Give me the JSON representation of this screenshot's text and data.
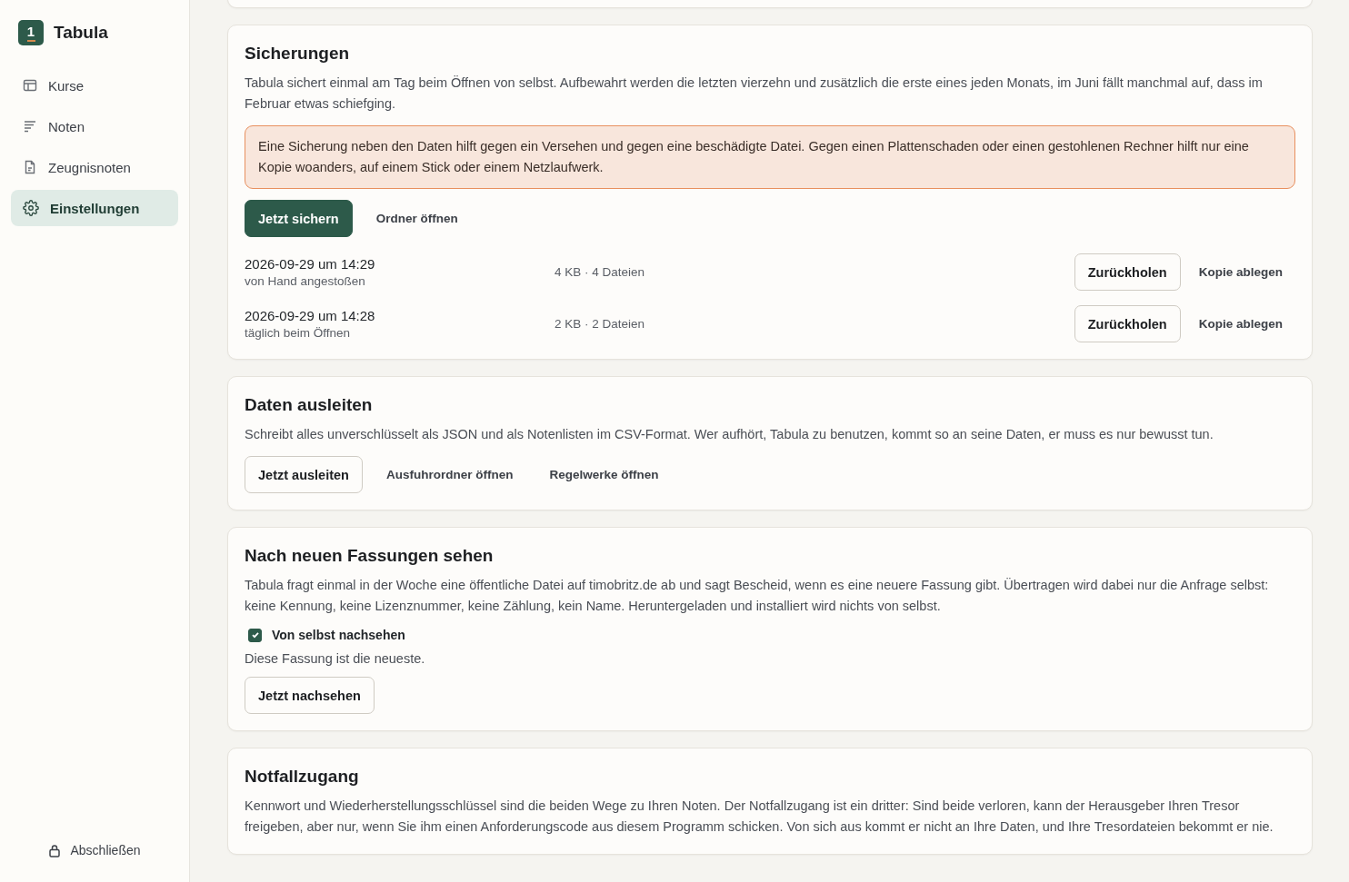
{
  "sidebar": {
    "app_name": "Tabula",
    "logo_text": "1",
    "items": [
      {
        "label": "Kurse",
        "selected": false
      },
      {
        "label": "Noten",
        "selected": false
      },
      {
        "label": "Zeugnisnoten",
        "selected": false
      },
      {
        "label": "Einstellungen",
        "selected": true
      }
    ],
    "lock_button": "Abschließen"
  },
  "sections": [
    {
      "title": "Sicherungen",
      "text": "Tabula sichert einmal am Tag beim Öffnen von selbst. Aufbewahrt werden die letzten vierzehn und zusätzlich die erste eines jeden Monats, im Juni fällt manchmal auf, dass im Februar etwas schiefging.",
      "notice": "Eine Sicherung neben den Daten hilft gegen ein Versehen und gegen eine beschädigte Datei. Gegen einen Plattenschaden oder einen gestohlenen Rechner hilft nur eine Kopie woanders, auf einem Stick oder einem Netzlaufwerk.",
      "buttons": [
        {
          "label": "Jetzt sichern",
          "kind": "primary"
        },
        {
          "label": "Ordner öffnen",
          "kind": "link"
        }
      ],
      "backups": [
        {
          "date": "2026-09-29 um 14:29",
          "origin": "von Hand angestoßen",
          "size": "4 KB · 4 Dateien",
          "restore": "Zurückholen",
          "copy": "Kopie ablegen"
        },
        {
          "date": "2026-09-29 um 14:28",
          "origin": "täglich beim Öffnen",
          "size": "2 KB · 2 Dateien",
          "restore": "Zurückholen",
          "copy": "Kopie ablegen"
        }
      ]
    },
    {
      "title": "Daten ausleiten",
      "text": "Schreibt alles unverschlüsselt als JSON und als Notenlisten im CSV-Format. Wer aufhört, Tabula zu benutzen, kommt so an seine Daten, er muss es nur bewusst tun.",
      "buttons": [
        {
          "label": "Jetzt ausleiten",
          "kind": "outline"
        },
        {
          "label": "Ausfuhrordner öffnen",
          "kind": "link"
        },
        {
          "label": "Regelwerke öffnen",
          "kind": "link"
        }
      ]
    },
    {
      "title": "Nach neuen Fassungen sehen",
      "text": "Tabula fragt einmal in der Woche eine öffentliche Datei auf timobritz.de ab und sagt Bescheid, wenn es eine neuere Fassung gibt. Übertragen wird dabei nur die Anfrage selbst: keine Kennung, keine Lizenznummer, keine Zählung, kein Name. Heruntergeladen und installiert wird nichts von selbst.",
      "checkbox": {
        "label": "Von selbst nachsehen",
        "checked": true
      },
      "status": "Diese Fassung ist die neueste.",
      "buttons": [
        {
          "label": "Jetzt nachsehen",
          "kind": "outline"
        }
      ]
    },
    {
      "title": "Notfallzugang",
      "text": "Kennwort und Wiederherstellungsschlüssel sind die beiden Wege zu Ihren Noten. Der Notfallzugang ist ein dritter: Sind beide verloren, kann der Herausgeber Ihren Tresor freigeben, aber nur, wenn Sie ihm einen Anforderungscode aus diesem Programm schicken. Von sich aus kommt er nicht an Ihre Daten, und Ihre Tresordateien bekommt er nie."
    }
  ]
}
